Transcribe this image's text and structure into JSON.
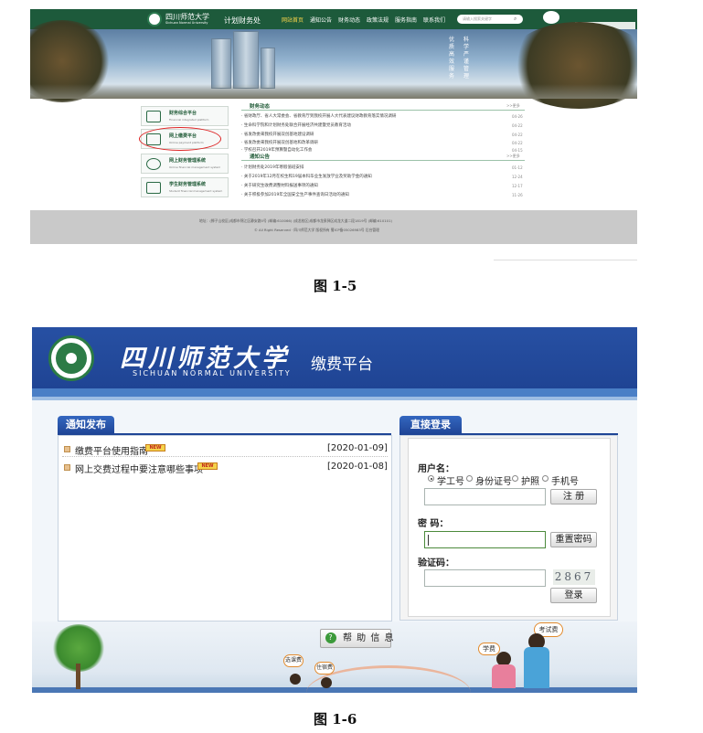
{
  "fig5": {
    "brand": "四川师范大学",
    "brand_en": "Sichuan Normal University",
    "office": "计划财务处",
    "nav": [
      "网站首页",
      "通知公告",
      "财务动态",
      "政策法规",
      "服务指南",
      "联系我们"
    ],
    "search_placeholder": "请输入搜索关键字",
    "banner_text": [
      "优",
      "质",
      "高",
      "效",
      "服",
      "务",
      "科",
      "学",
      "严",
      "谨",
      "管",
      "理"
    ],
    "side_items": [
      {
        "title": "财务综合平台",
        "sub": "Financial integrated platform"
      },
      {
        "title": "网上缴费平台",
        "sub": "Online payment platform"
      },
      {
        "title": "网上财务管理系统",
        "sub": "Online financial management system"
      },
      {
        "title": "学生财务管理系统",
        "sub": "Student financial management system"
      }
    ],
    "news_title": "财务动态",
    "more": ">>更多",
    "news": [
      {
        "text": "省财政厅、省人大常委会、省教育厅到我校开展人大代表建议财政教育落实情况调研",
        "date": "04-26"
      },
      {
        "text": "生命科学院和计划财务处联合开展经济共建暨党员教育活动",
        "date": "04-22"
      },
      {
        "text": "省发改委来我校开展双创基地建设调研",
        "date": "04-22"
      },
      {
        "text": "省发改委来我校开展双创基地和改革调研",
        "date": "04-22"
      },
      {
        "text": "学校召开2019年预算暨自动化工作会",
        "date": "04-15"
      }
    ],
    "notice_title": "通知公告",
    "notices": [
      {
        "text": "计划财务处2019年寒假值班安排",
        "date": "01-12"
      },
      {
        "text": "关于2019年12月在校生和19届本科毕业生发放学业及奖助学金的通知",
        "date": "12-24"
      },
      {
        "text": "关于研究生收费调整材料报送事项的通知",
        "date": "12-17"
      },
      {
        "text": "关于积极参加2019年全国安全生产事件查询日活动的通知",
        "date": "11-26"
      }
    ],
    "footer1": "地址：(狮子山校区)成都市锦江区静安路5号  (邮编:610066)      (成龙校区)成都市龙泉驿区成龙大道二段1819号  (邮编:610101)",
    "footer2": "© All Right Reserved · 四川师范大学 版权所有  蜀ICP备05026983号  后台管理",
    "caption": "图 1-5"
  },
  "fig6": {
    "university_cn": "四川师范大学",
    "university_en": "SICHUAN NORMAL UNIVERSITY",
    "platform": "缴费平台",
    "notice_tab": "通知发布",
    "notices": [
      {
        "title": "缴费平台使用指南",
        "badge": "NEW",
        "date": "[2020-01-09]"
      },
      {
        "title": "网上交费过程中要注意哪些事项",
        "badge": "NEW",
        "date": "[2020-01-08]"
      }
    ],
    "login_tab": "直接登录",
    "username_label": "用户名：",
    "id_types": [
      "学工号",
      "身份证号",
      "护照",
      "手机号"
    ],
    "register_button": "注 册",
    "password_label": "密 码：",
    "reset_button": "重置密码",
    "captcha_label": "验证码：",
    "captcha_value": "2867",
    "login_button": "登录",
    "help_button": "帮 助 信 息",
    "bubbles": [
      "学费",
      "考试费",
      "选课费",
      "住宿费"
    ],
    "caption": "图 1-6"
  },
  "colors": {
    "nav_green": "#1d5a3b",
    "header_blue": "#2750a3",
    "tab_blue": "#3467c0",
    "footer_grey": "#c9c9c9"
  }
}
